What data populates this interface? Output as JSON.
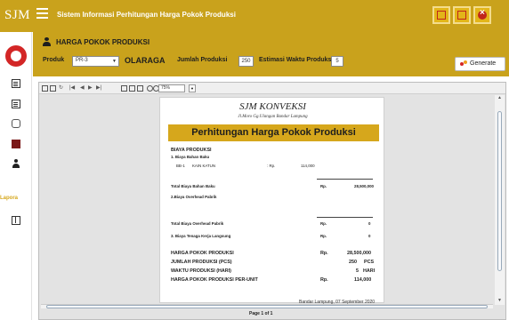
{
  "header": {
    "logo": "SJM",
    "app_title": "Sistem Informasi Perhitungan Harga Pokok Produksi"
  },
  "sidebar": {
    "label_laporan": "Lapora"
  },
  "panel": {
    "title": "HARGA POKOK PRODUKSI",
    "produk_label": "Produk",
    "produk_value": "PR-3",
    "produk_name": "OLARAGA",
    "jumlah_label": "Jumlah Produksi",
    "jumlah_value": "250",
    "estimasi_label": "Estimasi Waktu Produksi",
    "estimasi_value": "5",
    "generate_label": "Generate"
  },
  "viewer": {
    "zoom": "75%",
    "page_indicator": "Page 1 of 1"
  },
  "report": {
    "company": "SJM KONVEKSI",
    "address": "Jl.Moro Gg.Ulangan Bandar Lampung",
    "title": "Perhitungan Harga Pokok Produksi",
    "biaya_produksi": "BIAYA PRODUKSI",
    "bahan_baku_heading": "1. Biaya Bahan Baku",
    "bahan_code": "BB-1",
    "bahan_name": "KAIN KATUN",
    "bahan_currency": ": Rp.",
    "bahan_amount": "114,000",
    "total_bahan_label": "Total Biaya Bahan Baku",
    "total_bahan_currency": "Rp.",
    "total_bahan_value": "28,500,000",
    "overhead_heading": "2.Biaya Overhead Pabrik",
    "total_overhead_label": "Total Biaya Overhead Pabrik",
    "total_overhead_currency": "Rp.",
    "total_overhead_value": "0",
    "tenaga_label": "3. Biaya Tenaga Kerja Langsung",
    "tenaga_currency": "Rp.",
    "tenaga_value": "0",
    "hpp_label": "HARGA POKOK PRODUKSI",
    "hpp_currency": "Rp.",
    "hpp_value": "28,500,000",
    "jumlah_label": "JUMLAH PRODUKSI (PCS)",
    "jumlah_value": "250",
    "jumlah_unit": "PCS",
    "waktu_label": "WAKTU PRODUKSI (HARI)",
    "waktu_value": "5",
    "waktu_unit": "HARI",
    "unit_label": "HARGA POKOK PRODUKSI PER-UNIT",
    "unit_currency": "Rp.",
    "unit_value": "114,000",
    "footer_date": "Bandar Lampung, 07 September 2020"
  }
}
